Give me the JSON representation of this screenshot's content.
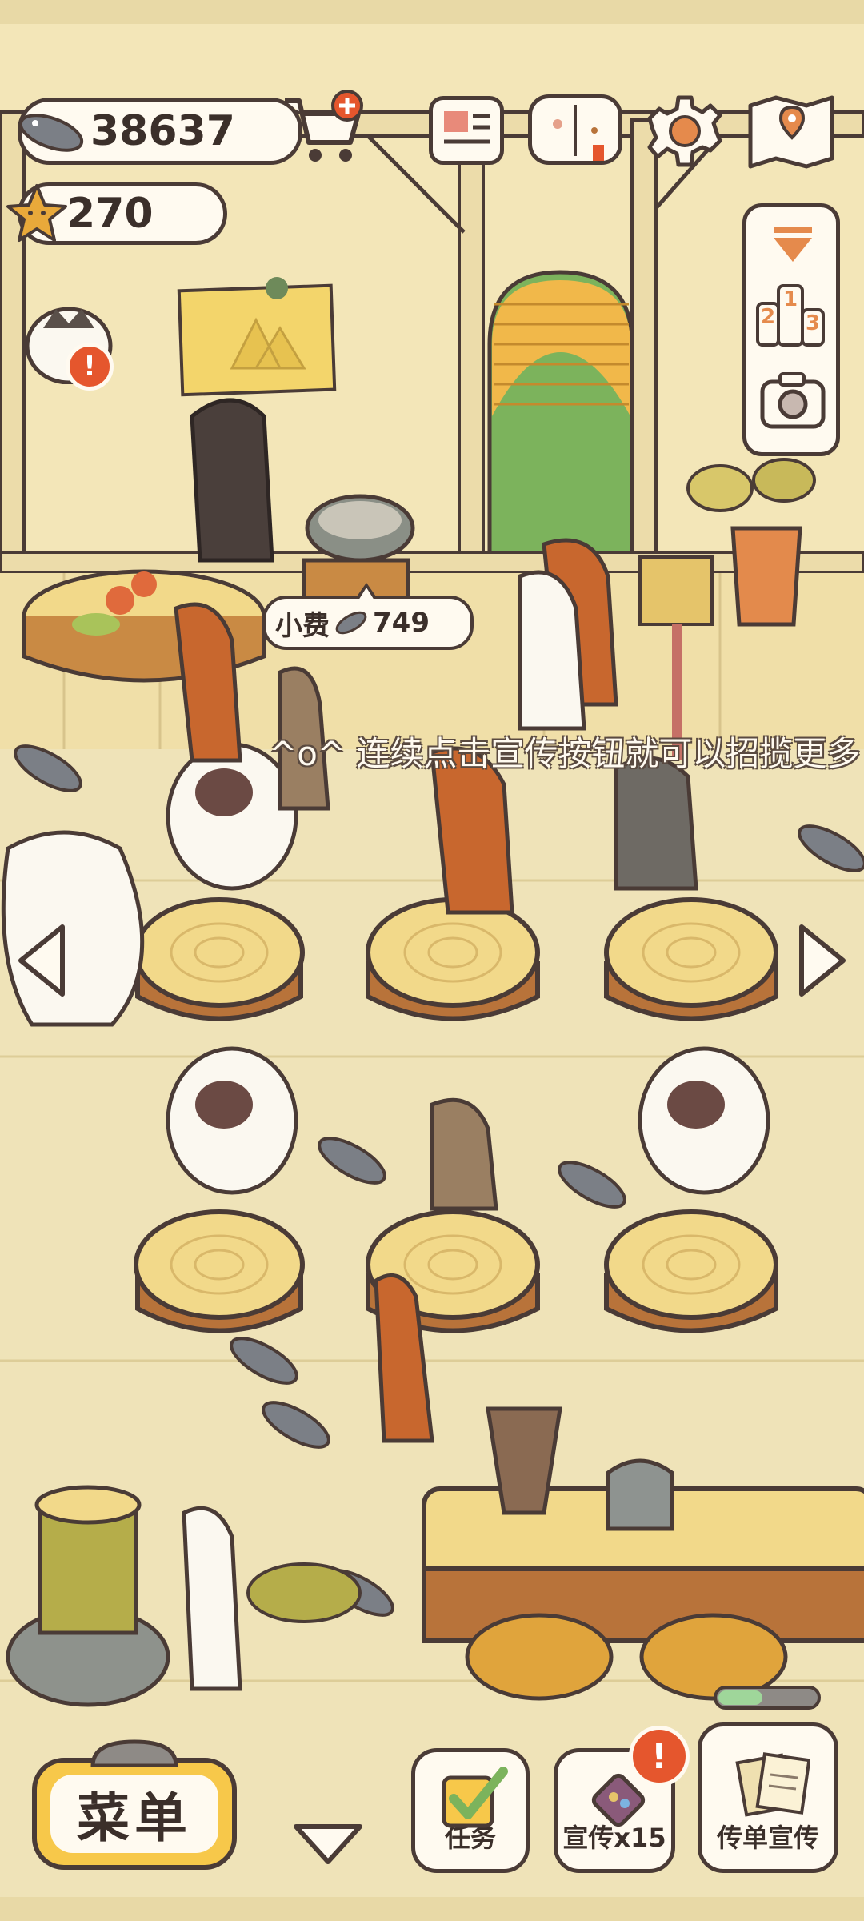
{
  "hud": {
    "fish_currency": "38637",
    "star_currency": "270"
  },
  "tip_bubble": {
    "label": "小费",
    "amount": "749"
  },
  "marquee": {
    "text": "^o^ 连续点击宣传按钮就可以招揽更多"
  },
  "bottom_bar": {
    "menu_label": "菜单",
    "tasks_label": "任务",
    "promo_label": "宣传x15",
    "flyer_label": "传单宣传",
    "alert_mark": "!"
  },
  "side_panel": {
    "ranking_digits": [
      "2",
      "1",
      "3"
    ]
  },
  "colors": {
    "outline": "#4a3b36",
    "cream": "#fffaf0",
    "alert_red": "#e5562d",
    "menu_yellow": "#f7c84a",
    "floor": "#efe3b8",
    "wall": "#f3e6b8",
    "wood_stump": "#f2d98a",
    "progress_green": "#9fd69a"
  },
  "icons": [
    "fish-icon",
    "shop-cart-icon",
    "star-icon",
    "news-icon",
    "recipe-book-icon",
    "settings-gear-icon",
    "map-icon",
    "collapse-arrow-icon",
    "ranking-podium-icon",
    "camera-icon",
    "left-arrow-icon",
    "right-arrow-icon",
    "down-arrow-icon",
    "task-checkbox-icon",
    "promo-gem-icon",
    "flyer-icon"
  ],
  "progress": {
    "fraction": 0.45
  }
}
